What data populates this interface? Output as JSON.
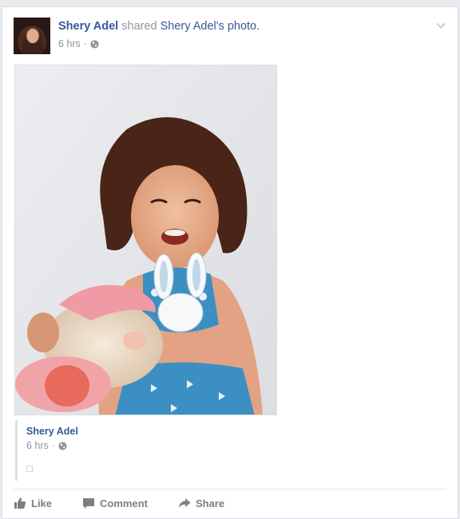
{
  "post": {
    "author": "Shery Adel",
    "action_text": "shared",
    "shared_owner": "Shery Adel's",
    "shared_object": "photo.",
    "time": "6 hrs",
    "separator": "·"
  },
  "shared": {
    "author": "Shery Adel",
    "time": "6 hrs",
    "separator": "·"
  },
  "actions": {
    "like": "Like",
    "comment": "Comment",
    "share": "Share"
  },
  "icons": {
    "privacy": "globe-icon",
    "menu": "chevron-down-icon",
    "like": "thumbs-up-icon",
    "comment": "comment-icon",
    "share": "share-arrow-icon"
  },
  "colors": {
    "link": "#365899",
    "meta": "#90949c",
    "action": "#7f7f7f",
    "background": "#e9ebee"
  }
}
